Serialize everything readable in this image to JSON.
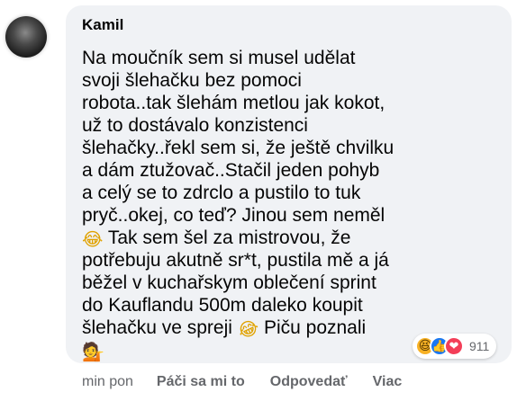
{
  "comment": {
    "author": "Kamil",
    "text_lines": [
      "Na moučník sem si musel udělat",
      "svoji šlehačku bez pomoci",
      "robota..tak šlehám metlou jak kokot,",
      "už to dostávalo konzistenci",
      "šlehačky..řekl sem si, že ještě chvilku",
      "a dám ztužovač..Stačil jeden pohyb",
      "a celý se to zdrclo a pustilo to tuk",
      "pryč..okej, co teď? Jinou sem neměl",
      " Tak sem šel za mistrovou, že",
      "potřebuju akutně sr*t, pustila mě a já",
      "běžel v kuchařskym oblečení sprint",
      "do Kauflandu 500m daleko koupit",
      "šlehačku ve spreji ",
      " Piču poznali"
    ],
    "emoji": {
      "laugh_crying": "😂",
      "rofl": "😂",
      "person_tipping_hand": "💁"
    }
  },
  "reactions": {
    "icons": [
      "haha-icon",
      "like-icon",
      "love-icon"
    ],
    "glyphs": {
      "haha": "😆",
      "like": "👍",
      "love": "❤"
    },
    "count": "911"
  },
  "actions": {
    "time": "min pon",
    "like_label": "Páči sa mi to",
    "reply_label": "Odpovedať",
    "more_label": "Viac"
  },
  "colors": {
    "bubble": "#f0f2f5",
    "text": "#050505",
    "meta": "#65676b",
    "like": "#1877f2",
    "love": "#f33e58",
    "haha": "#f7b125"
  }
}
